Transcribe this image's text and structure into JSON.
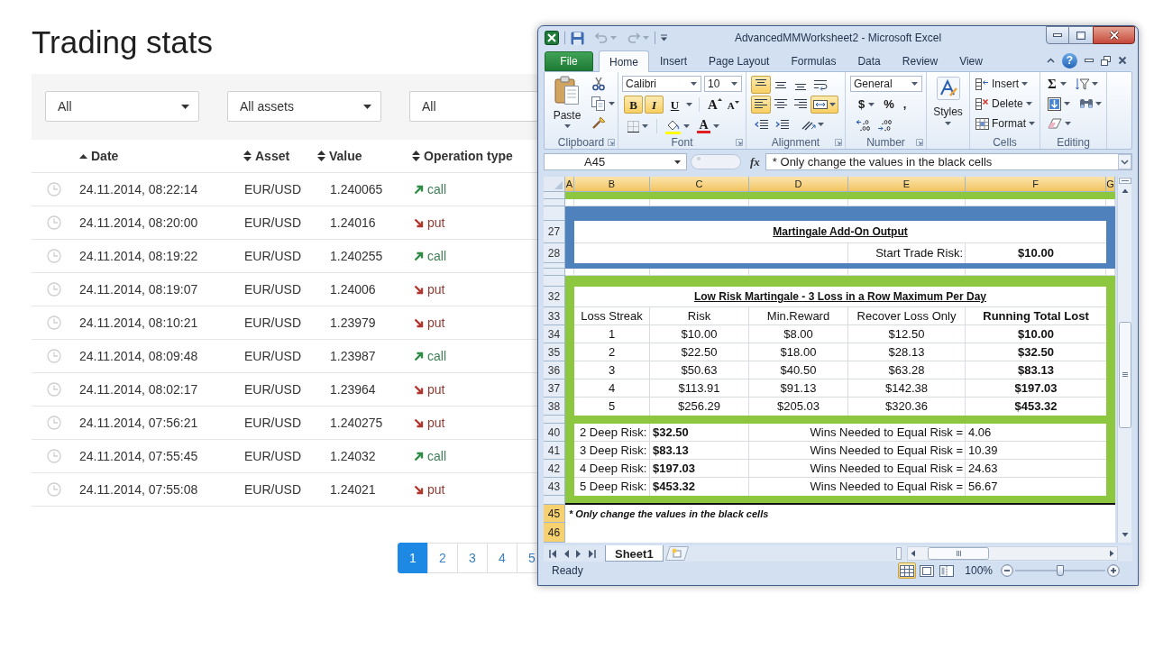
{
  "page": {
    "title": "Trading stats",
    "filters": [
      {
        "value": "All",
        "caret": true
      },
      {
        "value": "All assets",
        "caret": true
      },
      {
        "value": "All",
        "caret": false
      }
    ],
    "table": {
      "columns": [
        {
          "label": "Date",
          "sorted": true
        },
        {
          "label": "Asset",
          "sorted": false
        },
        {
          "label": "Value",
          "sorted": false
        },
        {
          "label": "Operation type",
          "sorted": false
        }
      ],
      "rows": [
        {
          "date": "24.11.2014, 08:22:14",
          "asset": "EUR/USD",
          "value": "1.240065",
          "operation": {
            "kind": "call",
            "label": "call"
          }
        },
        {
          "date": "24.11.2014, 08:20:00",
          "asset": "EUR/USD",
          "value": "1.24016",
          "operation": {
            "kind": "put",
            "label": "put"
          }
        },
        {
          "date": "24.11.2014, 08:19:22",
          "asset": "EUR/USD",
          "value": "1.240255",
          "operation": {
            "kind": "call",
            "label": "call"
          }
        },
        {
          "date": "24.11.2014, 08:19:07",
          "asset": "EUR/USD",
          "value": "1.24006",
          "operation": {
            "kind": "put",
            "label": "put"
          }
        },
        {
          "date": "24.11.2014, 08:10:21",
          "asset": "EUR/USD",
          "value": "1.23979",
          "operation": {
            "kind": "put",
            "label": "put"
          }
        },
        {
          "date": "24.11.2014, 08:09:48",
          "asset": "EUR/USD",
          "value": "1.23987",
          "operation": {
            "kind": "call",
            "label": "call"
          }
        },
        {
          "date": "24.11.2014, 08:02:17",
          "asset": "EUR/USD",
          "value": "1.23964",
          "operation": {
            "kind": "put",
            "label": "put"
          }
        },
        {
          "date": "24.11.2014, 07:56:21",
          "asset": "EUR/USD",
          "value": "1.240275",
          "operation": {
            "kind": "put",
            "label": "put"
          }
        },
        {
          "date": "24.11.2014, 07:55:45",
          "asset": "EUR/USD",
          "value": "1.24032",
          "operation": {
            "kind": "call",
            "label": "call"
          }
        },
        {
          "date": "24.11.2014, 07:55:08",
          "asset": "EUR/USD",
          "value": "1.24021",
          "operation": {
            "kind": "put",
            "label": "put"
          }
        }
      ]
    },
    "pagination": [
      {
        "label": "1",
        "selected": true
      },
      {
        "label": "2",
        "selected": false
      },
      {
        "label": "3",
        "selected": false
      },
      {
        "label": "4",
        "selected": false
      },
      {
        "label": "5",
        "selected": false
      }
    ]
  },
  "excel": {
    "window": {
      "title": "AdvancedMMWorksheet2 - Microsoft Excel",
      "help_label": "?"
    },
    "ribbon_tabs": [
      {
        "label": "File",
        "kind": "file",
        "selected": false
      },
      {
        "label": "Home",
        "kind": "tab",
        "selected": true
      },
      {
        "label": "Insert",
        "kind": "tab",
        "selected": false
      },
      {
        "label": "Page Layout",
        "kind": "tab",
        "selected": false
      },
      {
        "label": "Formulas",
        "kind": "tab",
        "selected": false
      },
      {
        "label": "Data",
        "kind": "tab",
        "selected": false
      },
      {
        "label": "Review",
        "kind": "tab",
        "selected": false
      },
      {
        "label": "View",
        "kind": "tab",
        "selected": false
      }
    ],
    "ribbon_groups": [
      {
        "kind": "clipboard",
        "label": "Clipboard",
        "paste_label": "Paste"
      },
      {
        "kind": "font",
        "label": "Font",
        "font_name": "Calibri",
        "font_size": "10",
        "styles": [
          {
            "kind": "bold",
            "label": "B",
            "on": true
          },
          {
            "kind": "italic",
            "label": "I",
            "on": true
          },
          {
            "kind": "underline",
            "label": "U",
            "on": false
          }
        ],
        "size_buttons": [
          {
            "kind": "grow",
            "label": "A"
          },
          {
            "kind": "shrink",
            "label": "A"
          }
        ],
        "font_color_label": "A"
      },
      {
        "kind": "alignment",
        "label": "Alignment",
        "buttons": [
          {
            "kind": "top",
            "on": true
          },
          {
            "kind": "middle",
            "on": false
          },
          {
            "kind": "bottom",
            "on": false
          },
          {
            "kind": "wrap",
            "on": false
          },
          {
            "kind": "left",
            "on": true
          },
          {
            "kind": "center",
            "on": false
          },
          {
            "kind": "right",
            "on": false
          },
          {
            "kind": "merge",
            "on": true
          }
        ]
      },
      {
        "kind": "number",
        "label": "Number",
        "format": "General",
        "symbols": [
          {
            "kind": "currency",
            "label": "$"
          },
          {
            "kind": "percent",
            "label": "%"
          },
          {
            "kind": "comma",
            "label": ","
          }
        ]
      },
      {
        "kind": "styles",
        "button_label": "Styles"
      },
      {
        "kind": "cells",
        "label": "Cells",
        "buttons": [
          {
            "kind": "insert",
            "label": "Insert"
          },
          {
            "kind": "delete",
            "label": "Delete"
          },
          {
            "kind": "format",
            "label": "Format"
          }
        ]
      },
      {
        "kind": "editing",
        "label": "Editing",
        "sum_symbol": "Σ"
      }
    ],
    "formula_bar": {
      "name_box": "A45",
      "function_label": "fx",
      "formula": "* Only change the values in the black cells"
    },
    "columns": [
      {
        "label": "A",
        "selected": true
      },
      {
        "label": "B",
        "selected": true
      },
      {
        "label": "C",
        "selected": true
      },
      {
        "label": "D",
        "selected": true
      },
      {
        "label": "E",
        "selected": true
      },
      {
        "label": "F",
        "selected": true
      },
      {
        "label": "G",
        "selected": true
      }
    ],
    "row_headers": [
      {
        "label": "27",
        "selected": false
      },
      {
        "label": "28",
        "selected": false
      },
      {
        "label": "32",
        "selected": false
      },
      {
        "label": "33",
        "selected": false
      },
      {
        "label": "34",
        "selected": false
      },
      {
        "label": "35",
        "selected": false
      },
      {
        "label": "36",
        "selected": false
      },
      {
        "label": "37",
        "selected": false
      },
      {
        "label": "38",
        "selected": false
      },
      {
        "label": "40",
        "selected": false
      },
      {
        "label": "41",
        "selected": false
      },
      {
        "label": "42",
        "selected": false
      },
      {
        "label": "43",
        "selected": false
      },
      {
        "label": "45",
        "selected": true
      },
      {
        "label": "46",
        "selected": true
      }
    ],
    "output_box": {
      "title": "Martingale Add-On Output",
      "label": "Start Trade Risk:",
      "value": "$10.00"
    },
    "martingale_table": {
      "title": "Low Risk Martingale - 3 Loss in a Row Maximum Per Day",
      "columns": [
        {
          "label": "Loss Streak",
          "bold": false
        },
        {
          "label": "Risk",
          "bold": false
        },
        {
          "label": "Min.Reward",
          "bold": false
        },
        {
          "label": "Recover Loss Only",
          "bold": false
        },
        {
          "label": "Running Total Lost",
          "bold": true
        }
      ],
      "rows": [
        [
          "1",
          "$10.00",
          "$8.00",
          "$12.50",
          "$10.00"
        ],
        [
          "2",
          "$22.50",
          "$18.00",
          "$28.13",
          "$32.50"
        ],
        [
          "3",
          "$50.63",
          "$40.50",
          "$63.28",
          "$83.13"
        ],
        [
          "4",
          "$113.91",
          "$91.13",
          "$142.38",
          "$197.03"
        ],
        [
          "5",
          "$256.29",
          "$205.03",
          "$320.36",
          "$453.32"
        ]
      ]
    },
    "deep_risk": [
      {
        "label": "2 Deep Risk:",
        "risk": "$32.50",
        "wins_label": "Wins Needed to Equal Risk =",
        "wins": "4.06"
      },
      {
        "label": "3 Deep Risk:",
        "risk": "$83.13",
        "wins_label": "Wins Needed to Equal Risk =",
        "wins": "10.39"
      },
      {
        "label": "4 Deep Risk:",
        "risk": "$197.03",
        "wins_label": "Wins Needed to Equal Risk =",
        "wins": "24.63"
      },
      {
        "label": "5 Deep Risk:",
        "risk": "$453.32",
        "wins_label": "Wins Needed to Equal Risk =",
        "wins": "56.67"
      }
    ],
    "note": "* Only change the values in the black cells",
    "sheet_tabs": [
      {
        "label": "Sheet1",
        "selected": true
      }
    ],
    "status_bar": {
      "status": "Ready",
      "views": [
        {
          "kind": "normal",
          "selected": true
        },
        {
          "kind": "page_layout",
          "selected": false
        },
        {
          "kind": "page_break",
          "selected": false
        }
      ],
      "zoom": "100%",
      "level": 0.5
    }
  }
}
